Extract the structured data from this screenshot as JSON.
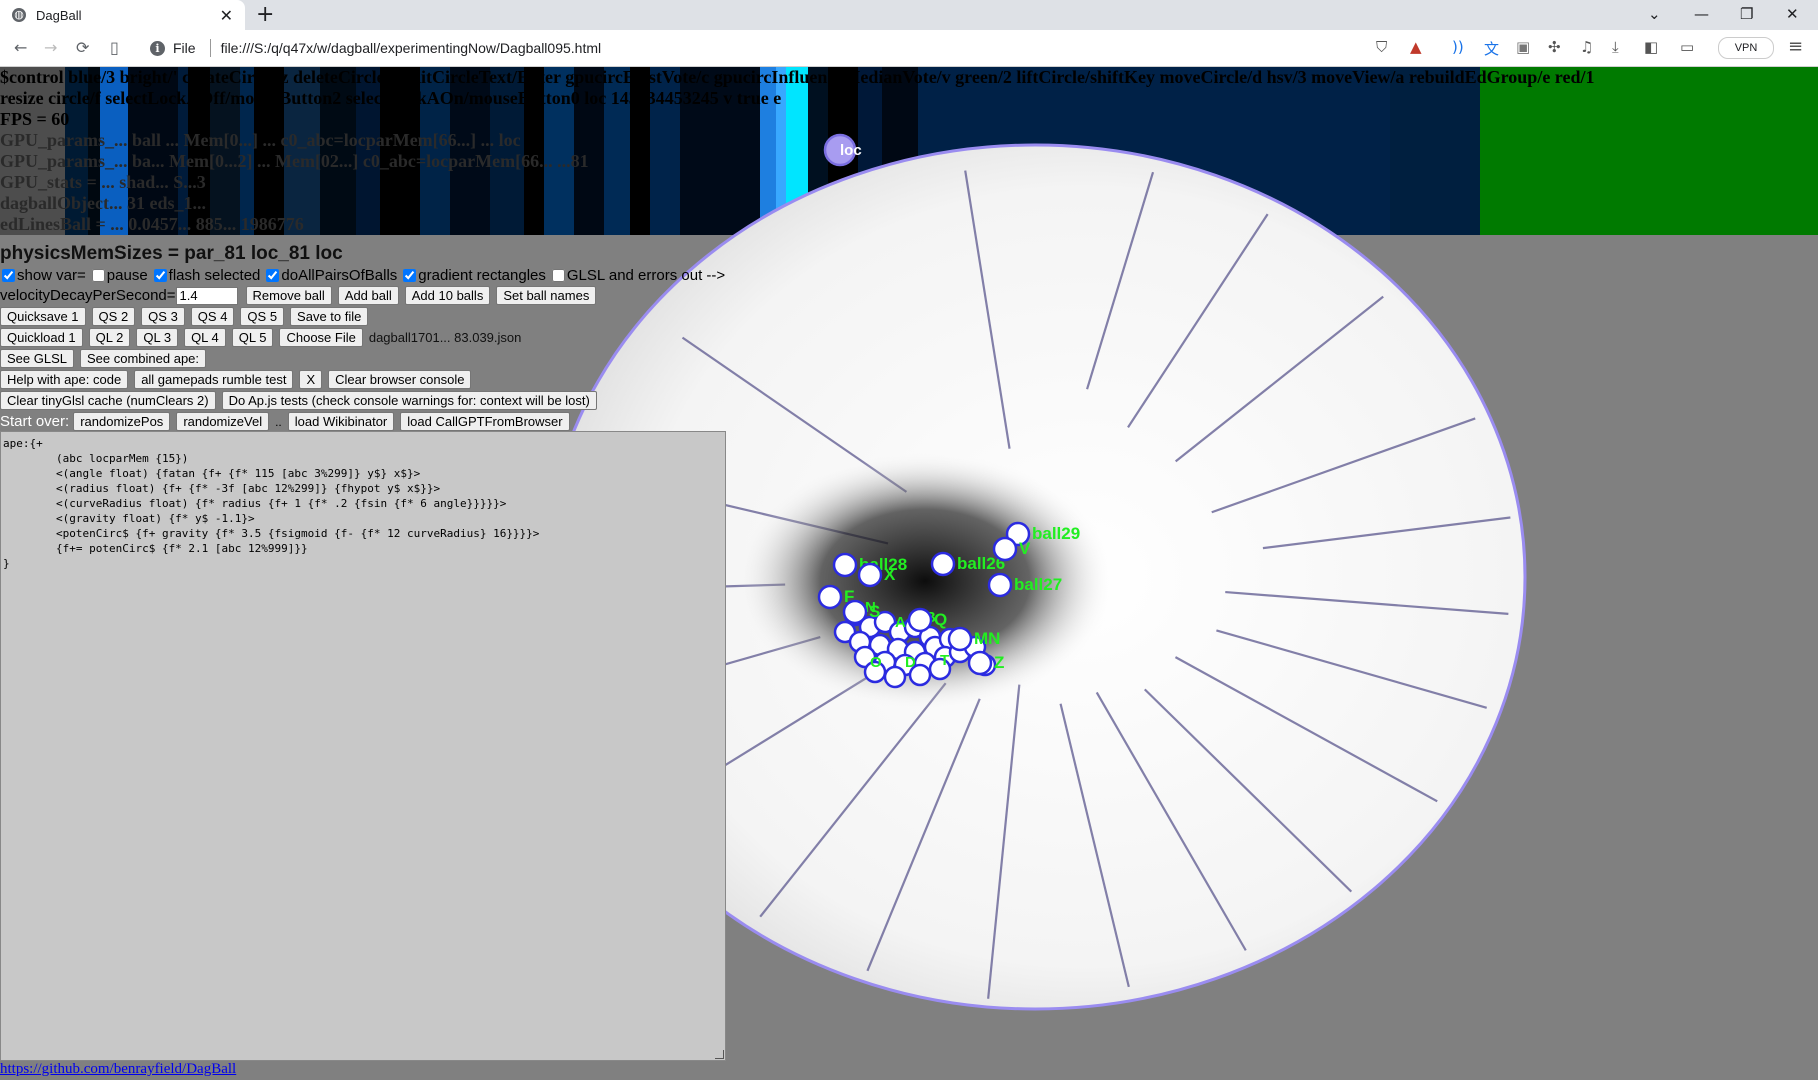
{
  "browser": {
    "tab_title": "DagBall",
    "url_protocol": "File",
    "url": "file:///S:/q/q47x/w/dagball/experimentingNow/Dagball095.html",
    "vpn_label": "VPN",
    "icons": {
      "favicon": "globe-icon",
      "back": "←",
      "forward": "→",
      "reload": "⟳",
      "bookmark": "▯",
      "min": "—",
      "restore": "❐",
      "close": "✕",
      "menu": "≡",
      "newtab": "+",
      "tabclose": "✕",
      "dropdown": "⌄"
    }
  },
  "debug": {
    "line1": "$control blue/3 bright/' createCircle/z deleteCircle/x editCircleText/Enter gpucircExistVote/c gpucircInfluenceMedianVote/v green/2 liftCircle/shiftKey moveCircle/d hsv/3 moveView/a rebuildEdGroup/e red/1",
    "line2": "resize circle/f selectLockAOff/mouseButton2 selectLockAOn/mouseButton0 loc 143334453245 v true e",
    "line3": "FPS = 60",
    "line4": "GPU_params_... ball ... Mem[0...] ... c0_abc=locparMem[66...] ... loc",
    "line5": "GPU_params_... ba... Mem[0...2] ... Mem[02...] c0_abc=locparMem[66... ...81",
    "line6": "GPU_stats = ... shad... S...3",
    "line7": "dagballObject... 31 eds_1...",
    "line8": "edLinesBall = ... 0.0457... 885... 1986776"
  },
  "physics": "physicsMemSizes = par_81 loc_81 loc",
  "checks": [
    {
      "label": "show var=",
      "checked": true
    },
    {
      "label": "pause",
      "checked": false
    },
    {
      "label": "flash selected",
      "checked": true
    },
    {
      "label": "doAllPairsOfBalls",
      "checked": true
    },
    {
      "label": "gradient rectangles",
      "checked": true
    },
    {
      "label": "GLSL and errors out -->",
      "checked": false
    }
  ],
  "velocity": {
    "label": "velocityDecayPerSecond=",
    "value": "1.4"
  },
  "buttons": {
    "remove_ball": "Remove ball",
    "add_ball": "Add ball",
    "add_10_balls": "Add 10 balls",
    "set_ball_names": "Set ball names",
    "quicksave1": "Quicksave 1",
    "qs2": "QS 2",
    "qs3": "QS 3",
    "qs4": "QS 4",
    "qs5": "QS 5",
    "save_to_file": "Save to file",
    "quickload1": "Quickload 1",
    "ql2": "QL 2",
    "ql3": "QL 3",
    "ql4": "QL 4",
    "ql5": "QL 5",
    "choose_file": "Choose File",
    "see_glsl": "See GLSL",
    "see_combined": "See combined ape:",
    "help_ape": "Help with ape: code",
    "rumble": "all gamepads rumble test",
    "x": "X",
    "clear_console": "Clear browser console",
    "clear_cache": "Clear tinyGlsl cache (numClears 2)",
    "apjs_tests": "Do Ap.js tests (check console warnings for: context will be lost)",
    "randomize_pos": "randomizePos",
    "randomize_vel": "randomizeVel",
    "dots": "..",
    "load_wiki": "load Wikibinator",
    "load_gpt": "load CallGPTFromBrowser"
  },
  "file_name": "dagball1701... 83.039.json",
  "start_over": "Start over:",
  "code": "ape:{+\n        (abc locparMem {15})\n        <(angle float) {fatan {f+ {f* 115 [abc 3%299]} y$} x$}>\n        <(radius float) {f+ {f* -3f [abc 12%299]} {fhypot y$ x$}}>\n        <(curveRadius float) {f* radius {f+ 1 {f* .2 {fsin {f* 6 angle}}}}}>\n        <(gravity float) {f* y$ -1.1}>\n        <potenCirc$ {f+ gravity {f* 3.5 {fsigmoid {f- {f* 12 curveRadius} 16}}}}>\n        {f+= potenCirc$ {f* 2.1 [abc 12%999]}}\n}",
  "link": "https://github.com/benrayfield/DagBall",
  "balls": [
    {
      "label": "loc"
    },
    {
      "label": "ball29"
    },
    {
      "label": "ball28"
    },
    {
      "label": "ball26"
    },
    {
      "label": "ball27"
    },
    {
      "label": "V"
    },
    {
      "label": "X"
    },
    {
      "label": "F"
    },
    {
      "label": "S"
    },
    {
      "label": "Q"
    },
    {
      "label": "MN"
    },
    {
      "label": "Z"
    }
  ]
}
